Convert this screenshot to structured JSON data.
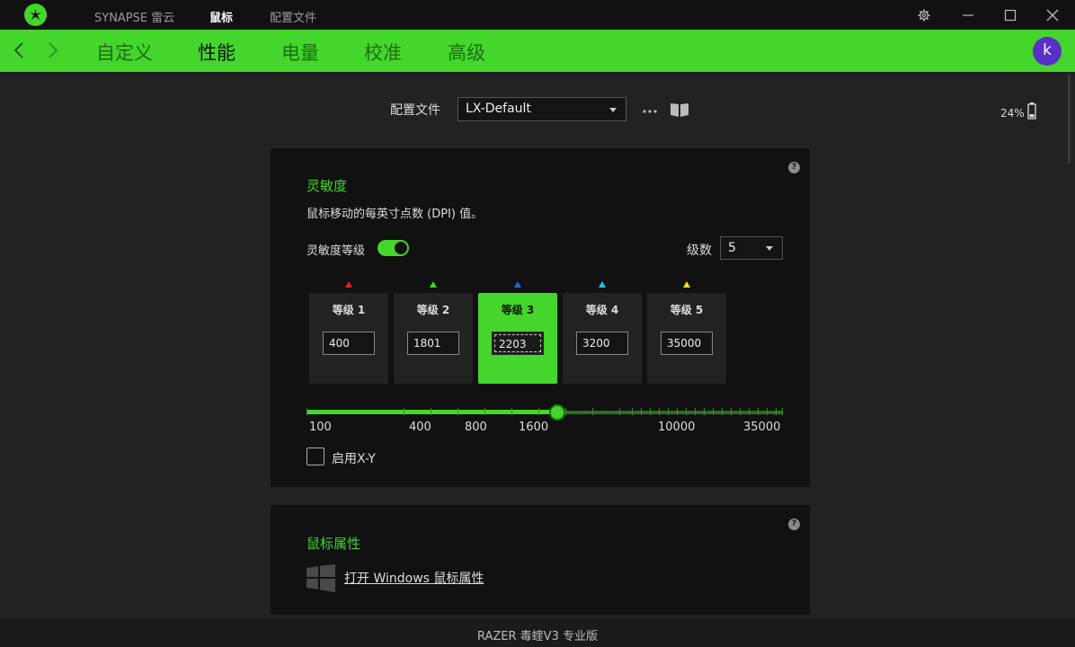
{
  "titlebar": {
    "tabs": [
      {
        "label": "SYNAPSE 雷云",
        "active": false
      },
      {
        "label": "鼠标",
        "active": true
      },
      {
        "label": "配置文件",
        "active": false
      }
    ]
  },
  "navbar": {
    "tabs": [
      {
        "label": "自定义",
        "active": false
      },
      {
        "label": "性能",
        "active": true
      },
      {
        "label": "电量",
        "active": false
      },
      {
        "label": "校准",
        "active": false
      },
      {
        "label": "高级",
        "active": false
      }
    ],
    "avatar_letter": "k"
  },
  "profile": {
    "label": "配置文件",
    "selected": "LX-Default"
  },
  "battery": {
    "percent_text": "24%",
    "level": 0.24
  },
  "sensitivity": {
    "title": "灵敏度",
    "description": "鼠标移动的每英寸点数 (DPI) 值。",
    "stages_label": "灵敏度等级",
    "stages_enabled": true,
    "stage_count_label": "级数",
    "stage_count": "5",
    "stages": [
      {
        "label": "等级 1",
        "value": "400",
        "color": "#e0251b",
        "active": false
      },
      {
        "label": "等级 2",
        "value": "1801",
        "color": "#44d62c",
        "active": false
      },
      {
        "label": "等级 3",
        "value": "2203",
        "color": "#1f6be0",
        "active": true
      },
      {
        "label": "等级 4",
        "value": "3200",
        "color": "#17c7e8",
        "active": false
      },
      {
        "label": "等级 5",
        "value": "35000",
        "color": "#f0e21a",
        "active": false
      }
    ],
    "slider_labels": [
      "100",
      "400",
      "800",
      "1600",
      "10000",
      "35000"
    ],
    "slider_value": 2203,
    "xy_label": "启用X-Y",
    "xy_enabled": false
  },
  "mouse_properties": {
    "title": "鼠标属性",
    "link": "打开 Windows 鼠标属性"
  },
  "footer": {
    "device_name": "RAZER 毒蝰V3 专业版"
  },
  "colors": {
    "accent": "#44d62c",
    "background": "#222222",
    "panel": "#111111"
  }
}
